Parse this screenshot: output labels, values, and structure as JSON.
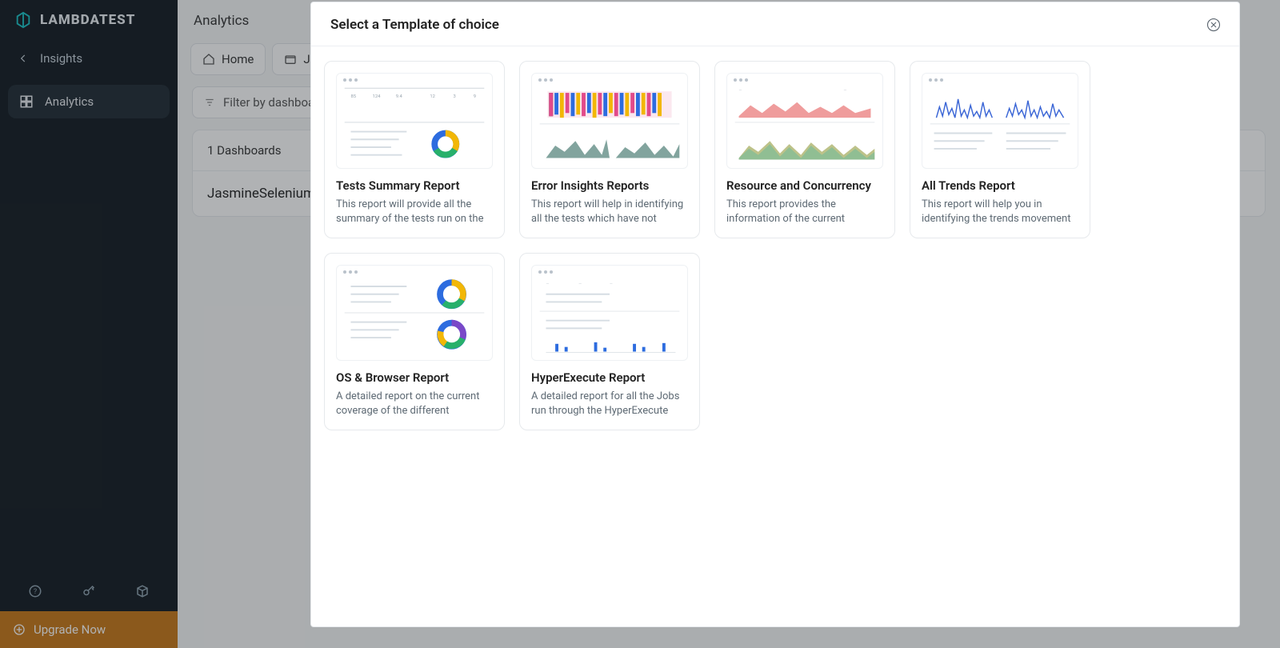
{
  "brand": {
    "name": "LAMBDATEST"
  },
  "sidebar": {
    "back_label": "Insights",
    "active_label": "Analytics",
    "upgrade_label": "Upgrade Now"
  },
  "header": {
    "title": "Analytics"
  },
  "tabs": [
    {
      "label": "Home"
    },
    {
      "label": "Jasn"
    }
  ],
  "filter": {
    "placeholder": "Filter by dashboard"
  },
  "panel": {
    "heading": "1 Dashboards",
    "row0": "JasmineSelenium"
  },
  "modal": {
    "title": "Select a Template of choice"
  },
  "templates": [
    {
      "title": "Tests Summary Report",
      "desc": "This report will provide all the summary of the tests run on the"
    },
    {
      "title": "Error Insights Reports",
      "desc": "This report will help in identifying all the tests which have not"
    },
    {
      "title": "Resource and Concurrency",
      "desc": "This report provides the information of the current"
    },
    {
      "title": "All Trends Report",
      "desc": "This report will help you in identifying the trends movement of"
    },
    {
      "title": "OS & Browser Report",
      "desc": "A detailed report on the current coverage of the different Borwsers"
    },
    {
      "title": "HyperExecute Report",
      "desc": "A detailed report for all the Jobs run through the HyperExecute"
    }
  ]
}
